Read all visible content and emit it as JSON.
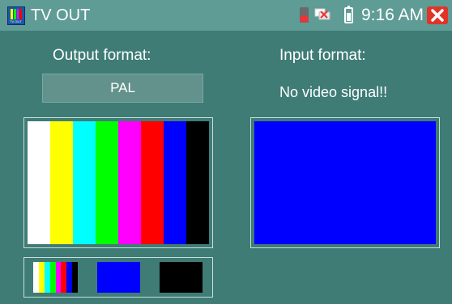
{
  "titlebar": {
    "title": "TV OUT",
    "app_icon_text": "TV OUT",
    "time": "9:16 AM"
  },
  "output": {
    "label": "Output format:",
    "format_value": "PAL"
  },
  "input": {
    "label": "Input format:",
    "status": "No video signal!!"
  },
  "colors": {
    "background": "#3f7c76",
    "titlebar": "#5f9c96",
    "input_preview": "#0000ff",
    "close_button": "#e13427"
  },
  "color_bars": [
    "#ffffff",
    "#ffff00",
    "#00ffff",
    "#00ff00",
    "#ff00ff",
    "#ff0000",
    "#0000ff",
    "#000000"
  ],
  "thumbnails": [
    "color-bars",
    "blue",
    "black"
  ],
  "icons": [
    "tv-out-app-icon",
    "sd-card-icon",
    "network-icon",
    "battery-icon",
    "close-icon"
  ]
}
